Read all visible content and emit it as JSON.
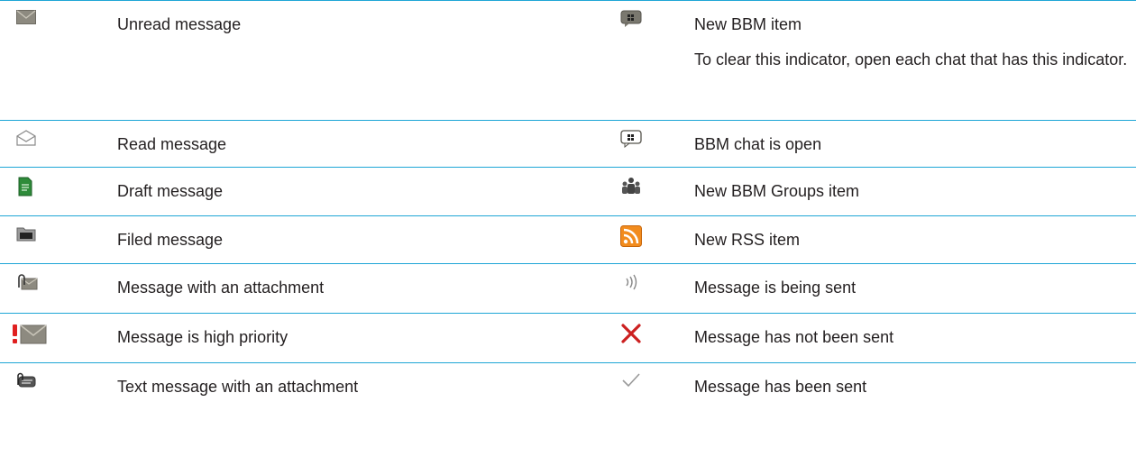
{
  "rows": [
    {
      "left": {
        "icon": "unread-message-icon",
        "label": "Unread message"
      },
      "right": {
        "icon": "new-bbm-item-icon",
        "label": "New BBM item",
        "note": "To clear this indicator, open each chat that has this indicator."
      }
    },
    {
      "left": {
        "icon": "read-message-icon",
        "label": "Read message"
      },
      "right": {
        "icon": "bbm-chat-open-icon",
        "label": "BBM chat is open"
      }
    },
    {
      "left": {
        "icon": "draft-message-icon",
        "label": "Draft message"
      },
      "right": {
        "icon": "bbm-groups-icon",
        "label": "New BBM Groups item"
      }
    },
    {
      "left": {
        "icon": "filed-message-icon",
        "label": "Filed message"
      },
      "right": {
        "icon": "rss-icon",
        "label": "New RSS item"
      }
    },
    {
      "left": {
        "icon": "attachment-message-icon",
        "label": "Message with an attachment"
      },
      "right": {
        "icon": "sending-icon",
        "label": "Message is being sent"
      }
    },
    {
      "left": {
        "icon": "high-priority-icon",
        "label": "Message is high priority"
      },
      "right": {
        "icon": "not-sent-icon",
        "label": "Message has not been sent"
      }
    },
    {
      "left": {
        "icon": "text-attachment-icon",
        "label": "Text message with an attachment"
      },
      "right": {
        "icon": "sent-check-icon",
        "label": "Message has been sent"
      }
    }
  ],
  "colors": {
    "rule": "#1fa6d6",
    "text": "#231f20",
    "priority": "#e02020",
    "error": "#cc2020",
    "rss": "#f28c1e"
  }
}
